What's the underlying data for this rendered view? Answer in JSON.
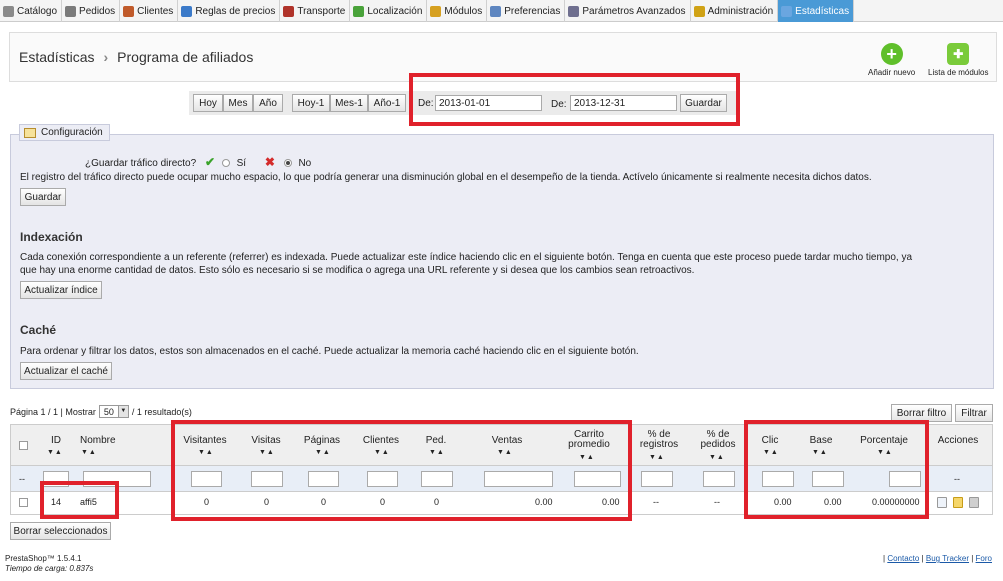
{
  "menu": [
    {
      "label": "Catálogo",
      "icon": "catalog-icon",
      "color": "#8a8a8a"
    },
    {
      "label": "Pedidos",
      "icon": "orders-icon",
      "color": "#7a7a7a"
    },
    {
      "label": "Clientes",
      "icon": "customers-icon",
      "color": "#c05a2a"
    },
    {
      "label": "Reglas de precios",
      "icon": "price-rules-icon",
      "color": "#3b7ac9"
    },
    {
      "label": "Transporte",
      "icon": "truck-icon",
      "color": "#b0332a"
    },
    {
      "label": "Localización",
      "icon": "globe-icon",
      "color": "#4aa33a"
    },
    {
      "label": "Módulos",
      "icon": "modules-icon",
      "color": "#d6a020"
    },
    {
      "label": "Preferencias",
      "icon": "preferences-icon",
      "color": "#5e86c0"
    },
    {
      "label": "Parámetros Avanzados",
      "icon": "wrench-icon",
      "color": "#6f6f8f"
    },
    {
      "label": "Administración",
      "icon": "key-icon",
      "color": "#d0a215"
    },
    {
      "label": "Estadísticas",
      "icon": "chart-icon",
      "color": "#6aa6e0",
      "active": true
    }
  ],
  "header": {
    "section": "Estadísticas",
    "page": "Programa de afiliados",
    "add_new": "Añadir nuevo",
    "module_list": "Lista de módulos"
  },
  "datebar": {
    "today": "Hoy",
    "month": "Mes",
    "year": "Año",
    "prev_day": "Hoy-1",
    "prev_month": "Mes-1",
    "prev_year": "Año-1",
    "from_label": "De:",
    "from_value": "2013-01-01",
    "to_label": "De:",
    "to_value": "2013-12-31",
    "save": "Guardar"
  },
  "config": {
    "legend": "Configuración",
    "direct_traffic_q": "¿Guardar tráfico directo?",
    "yes": "Sí",
    "no": "No",
    "direct_traffic_note": "El registro del tráfico directo puede ocupar mucho espacio, lo que podría generar una disminución global en el desempeño de la tienda. Actívelo únicamente si realmente necesita dichos datos.",
    "save": "Guardar",
    "index_title": "Indexación",
    "index_text_1": "Cada conexión correspondiente a un referente (referrer) es indexada. Puede actualizar este índice haciendo clic en el siguiente botón. Tenga en cuenta que este proceso puede tardar mucho tiempo, ya",
    "index_text_2": "que hay una enorme cantidad de datos. Esto sólo es necesario si se modifica o agrega una URL referente y si desea que los cambios sean retroactivos.",
    "index_button": "Actualizar índice",
    "cache_title": "Caché",
    "cache_text": "Para ordenar y filtrar los datos, estos son almacenados en el caché. Puede actualizar la memoria caché haciendo clic en el siguiente botón.",
    "cache_button": "Actualizar el caché"
  },
  "pagination": {
    "page": "Página 1 / 1 | Mostrar",
    "per_page": "50",
    "results": "/ 1 resultado(s)",
    "reset_filter": "Borrar filtro",
    "filter": "Filtrar"
  },
  "table": {
    "headers": {
      "id": "ID",
      "name": "Nombre",
      "visitors": "Visitantes",
      "visits": "Visitas",
      "pages": "Páginas",
      "customers": "Clientes",
      "orders": "Ped.",
      "sales": "Ventas",
      "cart_1": "Carrito",
      "cart_2": "promedio",
      "reg_1": "% de",
      "reg_2": "registros",
      "ord_1": "% de",
      "ord_2": "pedidos",
      "click": "Clic",
      "base": "Base",
      "percent": "Porcentaje",
      "actions": "Acciones"
    },
    "filter_id": "--",
    "filter_actions": "--",
    "row": {
      "id": "14",
      "name": "affi5",
      "visitors": "0",
      "visits": "0",
      "pages": "0",
      "customers": "0",
      "orders": "0",
      "sales": "0.00",
      "cart": "0.00",
      "reg": "--",
      "ord": "--",
      "click": "0.00",
      "base": "0.00",
      "percent": "0.00000000"
    }
  },
  "bulk_delete": "Borrar seleccionados",
  "footer": {
    "version": "PrestaShop™ 1.5.4.1",
    "load_time": "Tiempo de carga: 0.837s",
    "contact": "Contacto",
    "bug_tracker": "Bug Tracker",
    "forum": "Foro"
  }
}
